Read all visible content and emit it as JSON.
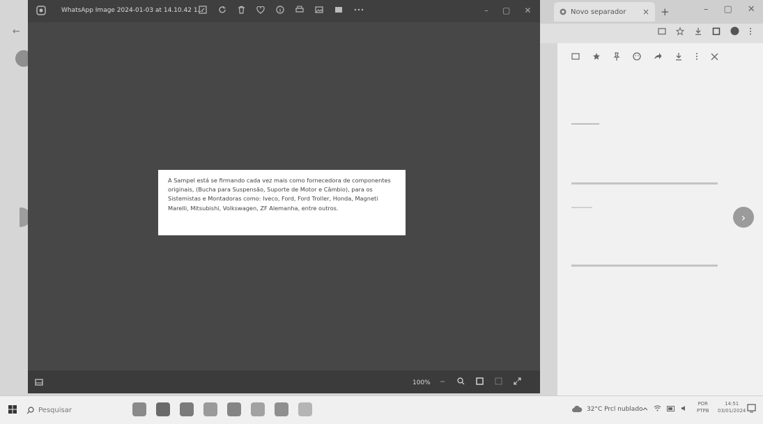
{
  "background_browser": {
    "tab_title": "Novo separador",
    "new_tab_label": "+",
    "close_tab_label": "×",
    "next_label": "›",
    "back_label": "←"
  },
  "viewer": {
    "title": "WhatsApp Image 2024-01-03 at 14.10.42 1...",
    "zoom": "100%",
    "image_text": "A Sampel está se firmando cada vez mais como fornecedora de componentes originais, (Bucha para Suspensão, Suporte de Motor e Câmbio), para os Sistemistas e Montadoras como: Iveco, Ford, Ford Troller, Honda, Magneti Marelli, Mitsubishi, Volkswagen, ZF Alemanha, entre outros."
  },
  "taskbar": {
    "search_placeholder": "Pesquisar",
    "weather": "32°C Prcl nublado",
    "language": "POR",
    "language_sub": "PTPB",
    "time": "14:51",
    "date": "03/01/2024"
  },
  "colors": {
    "viewer_bg": "#444444",
    "card_bg": "#ffffff",
    "taskbar_bg": "#f0f0f0"
  }
}
